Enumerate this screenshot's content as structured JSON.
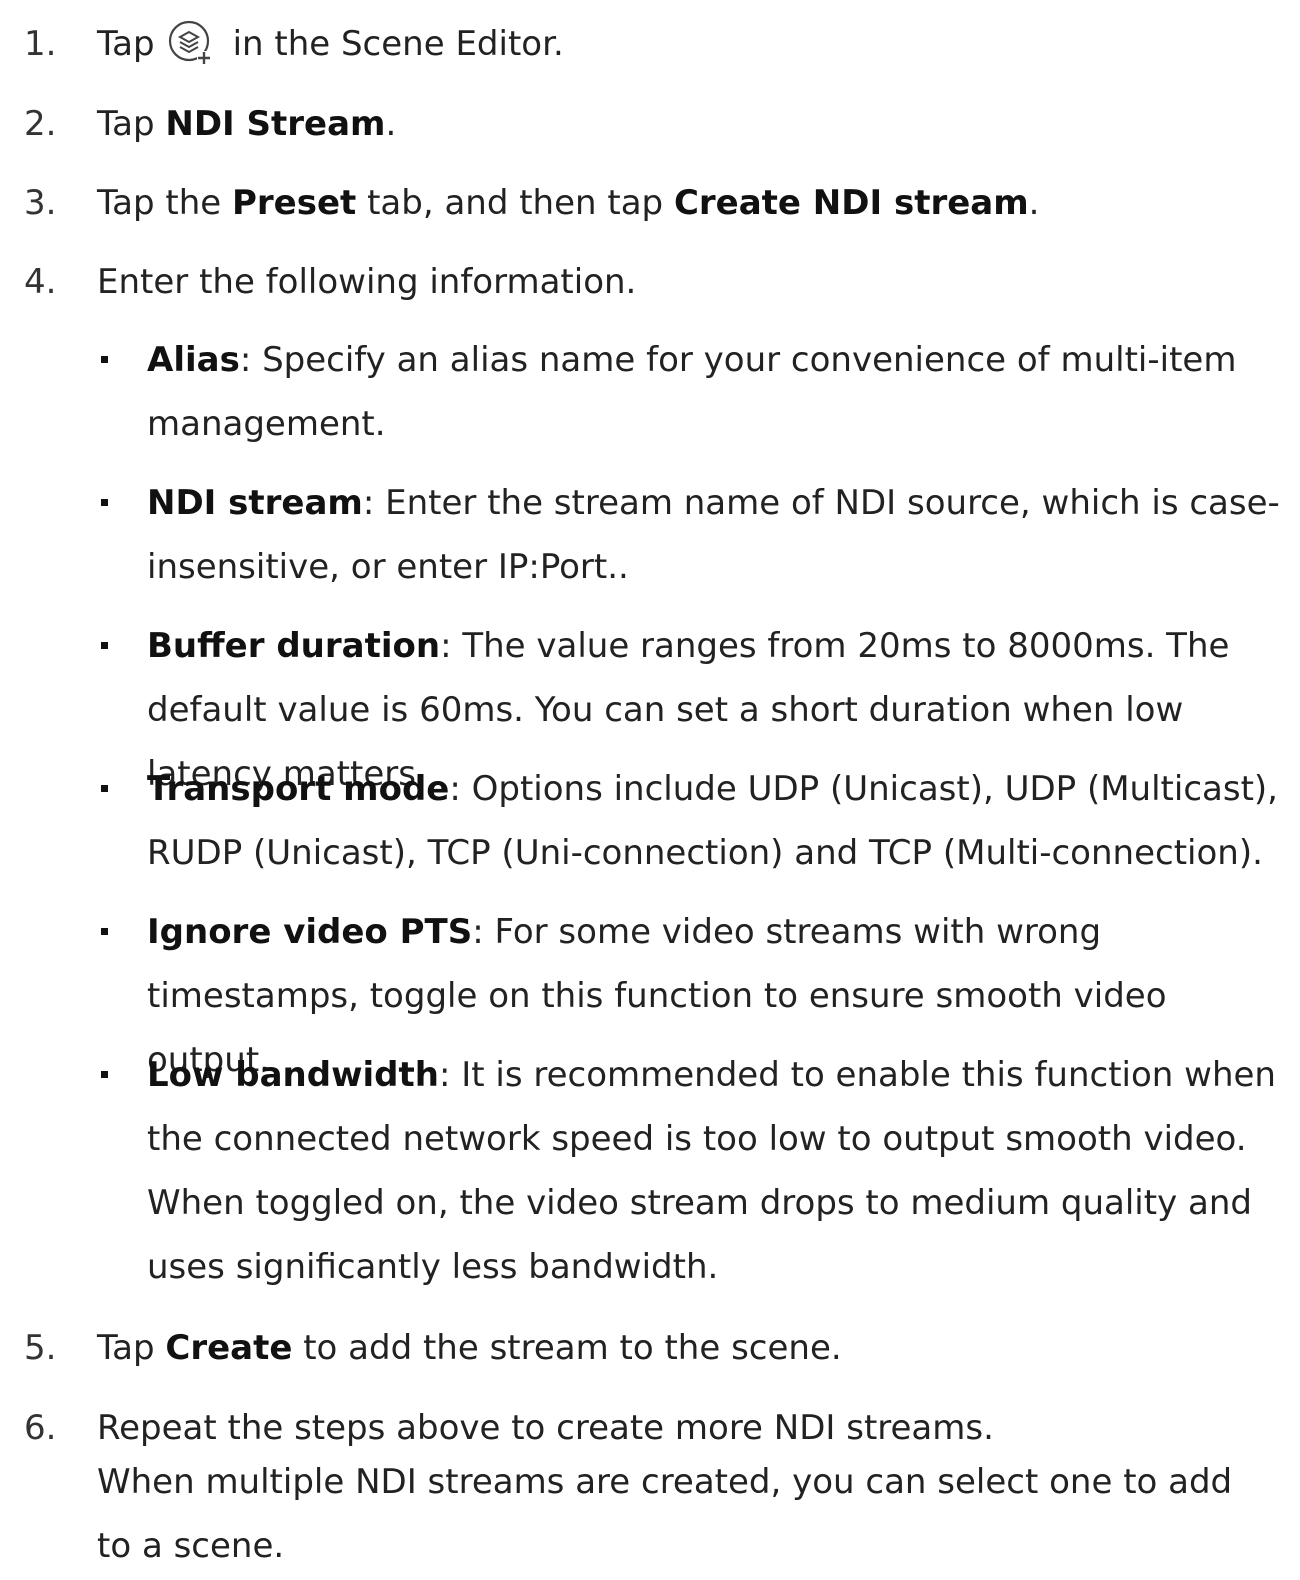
{
  "steps": {
    "s1": {
      "num": "1.",
      "pre": "Tap",
      "post": "in the Scene Editor.",
      "icon": "add-layer-icon"
    },
    "s2": {
      "num": "2.",
      "pre": "Tap ",
      "bold": "NDI Stream",
      "post": "."
    },
    "s3": {
      "num": "3.",
      "pre": "Tap the ",
      "bold1": "Preset",
      "mid": " tab, and then tap ",
      "bold2": "Create NDI stream",
      "post": "."
    },
    "s4": {
      "num": "4.",
      "text": "Enter the following information."
    },
    "s5": {
      "num": "5.",
      "pre": "Tap ",
      "bold": "Create",
      "post": " to add the stream to the scene."
    },
    "s6": {
      "num": "6.",
      "text": "Repeat the steps above to create more NDI streams.",
      "note": "When multiple NDI streams are created, you can select one to add to a scene."
    }
  },
  "bullets": [
    {
      "term": "Alias",
      "desc": ": Specify an alias name for your convenience of multi-item management."
    },
    {
      "term": "NDI stream",
      "desc": ": Enter the stream name of NDI source, which is case-insensitive, or enter IP:Port.."
    },
    {
      "term": "Buffer duration",
      "desc": ": The value ranges from 20ms to 8000ms. The default value is 60ms. You can set a short duration when low latency matters."
    },
    {
      "term": "Transport mode",
      "desc": ": Options include UDP (Unicast), UDP (Multicast), RUDP (Unicast), TCP (Uni-connection) and TCP (Multi-connection)."
    },
    {
      "term": "Ignore video PTS",
      "desc": ": For some video streams with wrong timestamps, toggle on this function to ensure smooth video output."
    },
    {
      "term": "Low bandwidth",
      "desc": ": It is recommended to enable this function when the connected network speed is too low to output smooth video. When toggled on, the video stream drops to medium quality and uses significantly less bandwidth."
    }
  ]
}
